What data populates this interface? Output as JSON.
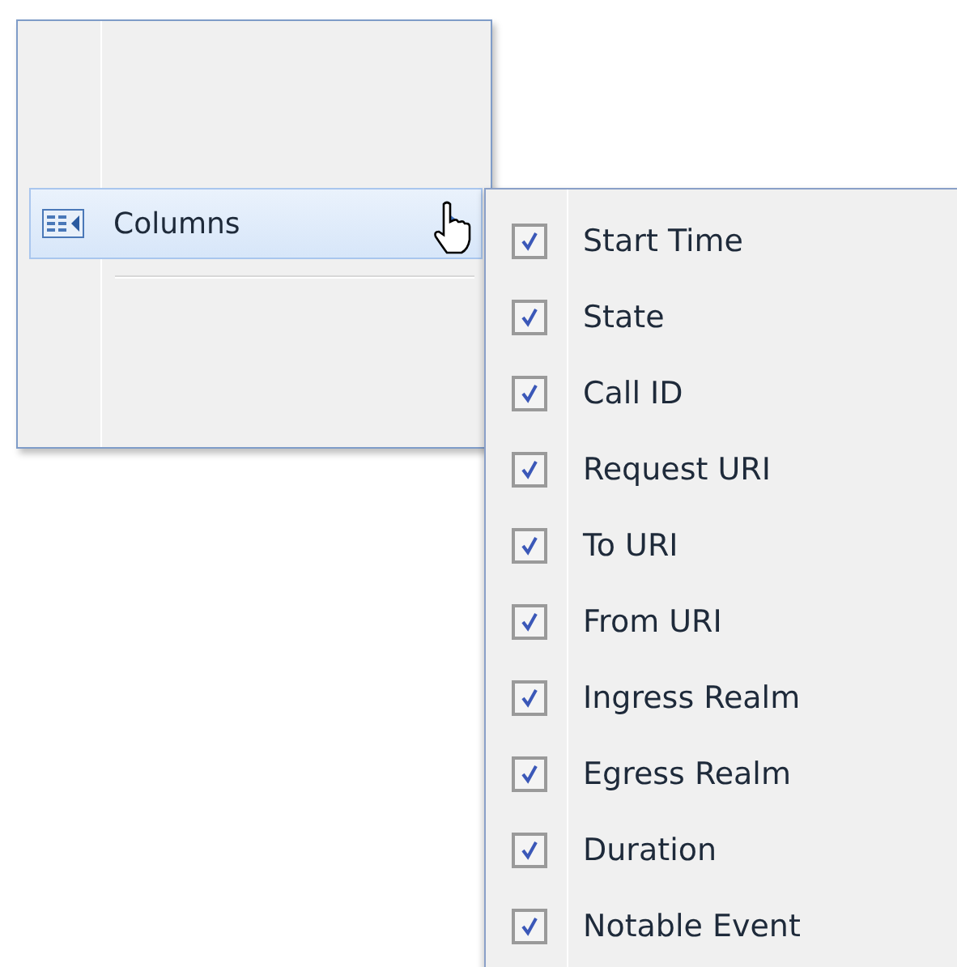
{
  "menu": {
    "items": [
      {
        "label": "Columns",
        "selected": true
      }
    ]
  },
  "submenu": {
    "items": [
      {
        "label": "Start Time",
        "checked": true
      },
      {
        "label": "State",
        "checked": true
      },
      {
        "label": "Call ID",
        "checked": true
      },
      {
        "label": "Request URI",
        "checked": true
      },
      {
        "label": "To URI",
        "checked": true
      },
      {
        "label": "From URI",
        "checked": true
      },
      {
        "label": "Ingress Realm",
        "checked": true
      },
      {
        "label": "Egress Realm",
        "checked": true
      },
      {
        "label": "Duration",
        "checked": true
      },
      {
        "label": "Notable Event",
        "checked": true
      }
    ]
  }
}
